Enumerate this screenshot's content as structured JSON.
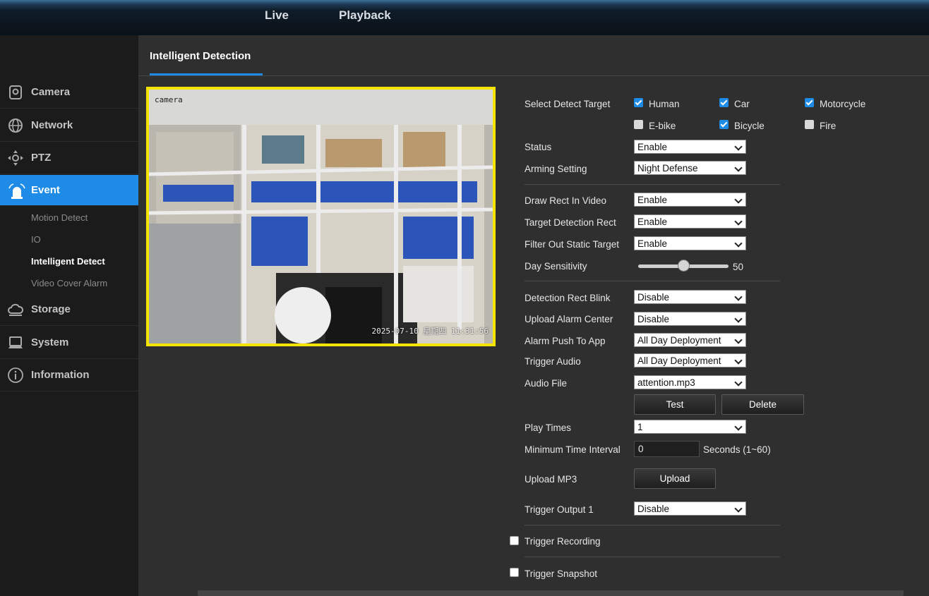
{
  "topnav": {
    "live": "Live",
    "playback": "Playback"
  },
  "sidebar": {
    "items": [
      {
        "label": "Camera",
        "icon": "camera-icon"
      },
      {
        "label": "Network",
        "icon": "globe-icon"
      },
      {
        "label": "PTZ",
        "icon": "ptz-arrows-icon"
      },
      {
        "label": "Event",
        "icon": "alarm-icon"
      },
      {
        "label": "Storage",
        "icon": "cloud-icon"
      },
      {
        "label": "System",
        "icon": "laptop-icon"
      },
      {
        "label": "Information",
        "icon": "info-icon"
      }
    ],
    "event_sub": [
      "Motion Detect",
      "IO",
      "Intelligent Detect",
      "Video Cover Alarm"
    ]
  },
  "tab": {
    "title": "Intelligent Detection"
  },
  "video": {
    "timestamp": "2025-07-10 星期四 11:31:56",
    "channel_label": "camera"
  },
  "form": {
    "select_detect_target": "Select Detect Target",
    "targets": [
      {
        "label": "Human",
        "checked": true
      },
      {
        "label": "Car",
        "checked": true
      },
      {
        "label": "Motorcycle",
        "checked": true
      },
      {
        "label": "E-bike",
        "checked": false
      },
      {
        "label": "Bicycle",
        "checked": true
      },
      {
        "label": "Fire",
        "checked": false
      }
    ],
    "status": {
      "label": "Status",
      "value": "Enable"
    },
    "arming": {
      "label": "Arming Setting",
      "value": "Night Defense"
    },
    "draw_rect": {
      "label": "Draw Rect In Video",
      "value": "Enable"
    },
    "target_rect": {
      "label": "Target Detection Rect",
      "value": "Enable"
    },
    "filter_static": {
      "label": "Filter Out Static Target",
      "value": "Enable"
    },
    "day_sensitivity": {
      "label": "Day Sensitivity",
      "value": "50",
      "fraction": 0.5
    },
    "rect_blink": {
      "label": "Detection Rect Blink",
      "value": "Disable"
    },
    "upload_alarm": {
      "label": "Upload Alarm Center",
      "value": "Disable"
    },
    "push_app": {
      "label": "Alarm Push To App",
      "value": "All Day Deployment"
    },
    "trigger_audio": {
      "label": "Trigger Audio",
      "value": "All Day Deployment"
    },
    "audio_file": {
      "label": "Audio File",
      "value": "attention.mp3"
    },
    "test_button": "Test",
    "delete_button": "Delete",
    "play_times": {
      "label": "Play Times",
      "value": "1"
    },
    "min_interval": {
      "label": "Minimum Time Interval",
      "value": "0",
      "unit": "Seconds (1~60)"
    },
    "upload_mp3": {
      "label": "Upload MP3",
      "button": "Upload"
    },
    "trigger_output": {
      "label": "Trigger Output 1",
      "value": "Disable"
    },
    "trigger_recording": {
      "label": "Trigger Recording",
      "checked": false
    },
    "trigger_snapshot": {
      "label": "Trigger Snapshot",
      "checked": false
    }
  },
  "colors": {
    "accent": "#1e8ce6",
    "video_border": "#f4e400",
    "sidebar_bg": "#1b1b1b",
    "main_bg": "#2f2f2f"
  }
}
